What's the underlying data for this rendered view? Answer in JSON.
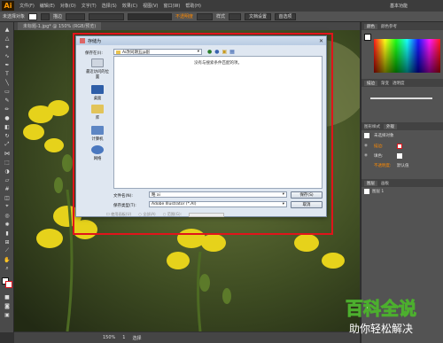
{
  "app": {
    "logo": "Ai"
  },
  "menu": {
    "items": [
      "文件(F)",
      "编辑(E)",
      "对象(O)",
      "文字(T)",
      "选择(S)",
      "效果(C)",
      "视图(V)",
      "窗口(W)",
      "帮助(H)"
    ],
    "workspace": "基本功能"
  },
  "control_bar": {
    "selection_label": "未选择对象",
    "stroke_label": "描边",
    "opacity_label": "不透明度",
    "style_label": "样式",
    "doc_settings": "文档设置",
    "prefs": "首选项"
  },
  "document": {
    "tab_title": "未标题-1.jpg* @ 150% (RGB/预览)"
  },
  "status": {
    "zoom": "150%",
    "page": "1",
    "mode": "选择"
  },
  "right_panel": {
    "color_tabs": [
      "颜色",
      "颜色参考"
    ],
    "stroke_tabs": [
      "描边",
      "渐变",
      "透明度"
    ],
    "appearance_tabs": [
      "外观",
      "图形样式"
    ],
    "appearance": {
      "title": "未选择对象",
      "stroke_label": "描边:",
      "fill_label": "填色:",
      "opacity_label": "不透明度:",
      "opacity_value": "默认值"
    },
    "layers_tabs": [
      "图层",
      "画板"
    ],
    "layer_name": "图层 1"
  },
  "dialog": {
    "title": "存储为",
    "save_in_label": "保存在(I):",
    "save_in_value": "Ai改同期五jp副",
    "empty_message": "没有与搜索条件匹配的项。",
    "places": [
      {
        "label": "最近访问的位置",
        "icon": "recent-icon"
      },
      {
        "label": "桌面",
        "icon": "desktop-icon"
      },
      {
        "label": "库",
        "icon": "library-icon"
      },
      {
        "label": "计算机",
        "icon": "computer-icon"
      },
      {
        "label": "网络",
        "icon": "network-icon"
      }
    ],
    "filename_label": "文件名(N):",
    "filename_value": "略 ai",
    "filetype_label": "保存类型(T):",
    "filetype_value": "Adobe Illustrator (*.AI)",
    "save_button": "保存(S)",
    "cancel_button": "取消",
    "options": [
      "使用画板(U)",
      "全部(A)",
      "范围(G):"
    ]
  },
  "watermark": {
    "line1": "百科全说",
    "line2": "助你轻松解决"
  },
  "colors": {
    "red_box": "#e0141b",
    "watermark_green": "#4caf2e",
    "flower_yellow": "#e6d21b"
  }
}
